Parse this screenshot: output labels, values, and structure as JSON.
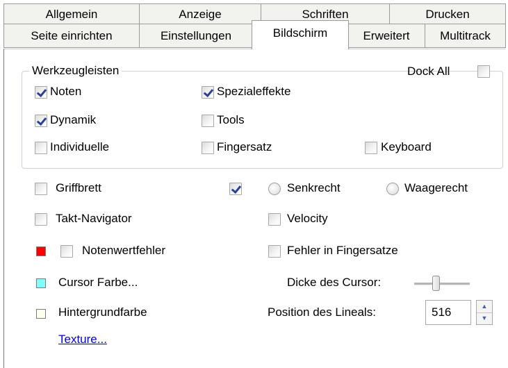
{
  "tabs": {
    "row1": [
      "Allgemein",
      "Anzeige",
      "Schriften",
      "Drucken"
    ],
    "row2": [
      "Seite einrichten",
      "Einstellungen",
      "Bildschirm",
      "Erweitert",
      "Multitrack"
    ],
    "active": "Bildschirm"
  },
  "toolbars_group": {
    "title": "Werkzeugleisten",
    "dock_all": {
      "label": "Dock All",
      "checked": false
    },
    "items": [
      {
        "label": "Noten",
        "checked": true
      },
      {
        "label": "Spezialeffekte",
        "checked": true
      },
      {
        "label": "Dynamik",
        "checked": true
      },
      {
        "label": "Tools",
        "checked": false
      },
      {
        "label": "Individuelle",
        "checked": false
      },
      {
        "label": "Fingersatz",
        "checked": false
      },
      {
        "label": "Keyboard",
        "checked": false
      }
    ]
  },
  "options": {
    "griffbrett": {
      "label": "Griffbrett",
      "checked": false
    },
    "orientation_enabled": true,
    "senkrecht": "Senkrecht",
    "waagerecht": "Waagerecht",
    "takt_navigator": {
      "label": "Takt-Navigator",
      "checked": false
    },
    "velocity": {
      "label": "Velocity",
      "checked": false
    },
    "notenwertfehler": {
      "label": "Notenwertfehler",
      "checked": false,
      "color": "#ff0000"
    },
    "fehler_fingersatze": {
      "label": "Fehler in Fingersatze",
      "checked": false
    },
    "cursor_farbe": {
      "label": "Cursor Farbe...",
      "color": "#80ffff"
    },
    "dicke_cursor": {
      "label": "Dicke des Cursor:"
    },
    "hintergrundfarbe": {
      "label": "Hintergrundfarbe",
      "color": "#ffffee"
    },
    "position_lineal": {
      "label": "Position des Lineals:",
      "value": "516"
    },
    "texture_link": "Texture..."
  },
  "colors": {
    "tab_bg": "#f2f2ee",
    "check_color": "#2a3f9e",
    "link_color": "#0000ee"
  }
}
